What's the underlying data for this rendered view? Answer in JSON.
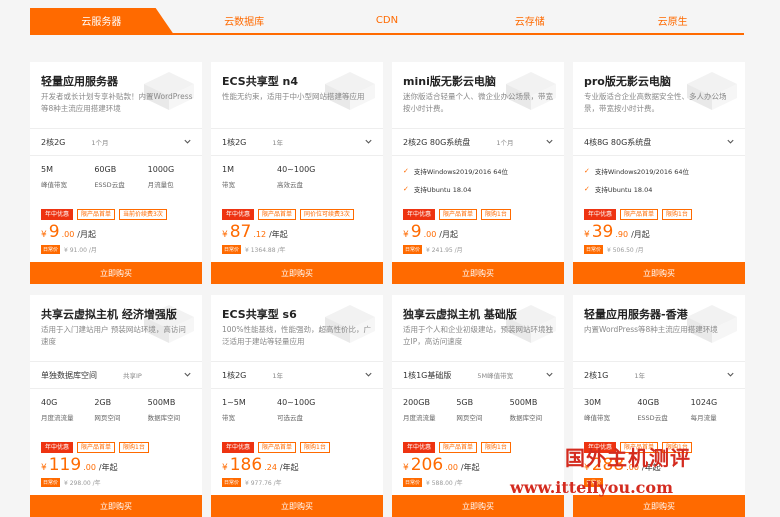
{
  "tabs": [
    "云服务器",
    "云数据库",
    "CDN",
    "云存储",
    "云原生"
  ],
  "cards": [
    {
      "title": "轻量应用服务器",
      "desc": "开发者或长计划专享补贴款！内置WordPress等8种主流应用搭建环境",
      "selector": "2核2G",
      "selector_sub": "1个月",
      "specs": [
        {
          "value": "5M",
          "label": "峰值带宽"
        },
        {
          "value": "60GB",
          "label": "ESSD云盘"
        },
        {
          "value": "1000G",
          "label": "月流量包"
        }
      ],
      "tags": [
        "年中优惠",
        "限产品首单",
        "当前价续费3次"
      ],
      "currency": "¥",
      "price_int": "9",
      "price_dec": ".00",
      "unit": "/月起",
      "orig_badge": "日常价",
      "orig": "¥ 91.00 /月",
      "buy": "立即购买"
    },
    {
      "title": "ECS共享型 n4",
      "desc": "性能无约束，适用于中小型网站搭建等应用",
      "selector": "1核2G",
      "selector_sub": "1年",
      "specs": [
        {
          "value": "1M",
          "label": "带宽"
        },
        {
          "value": "40~100G",
          "label": "高效云盘"
        }
      ],
      "tags": [
        "年中优惠",
        "限产品首单",
        "同价位可续费3次"
      ],
      "currency": "¥",
      "price_int": "87",
      "price_dec": ".12",
      "unit": "/年起",
      "orig_badge": "日常价",
      "orig": "¥ 1364.88 /年",
      "buy": "立即购买"
    },
    {
      "title": "mini版无影云电脑",
      "desc": "迷你版适合轻量个人、微企业办公场景，带宽按小时计费。",
      "selector": "2核2G 80G系统盘",
      "selector_sub": "1个月",
      "features": [
        "支持Windows2019/2016 64位",
        "支持Ubuntu 18.04"
      ],
      "tags": [
        "年中优惠",
        "限产品首单",
        "限购1台"
      ],
      "currency": "¥",
      "price_int": "9",
      "price_dec": ".00",
      "unit": "/月起",
      "orig_badge": "日常价",
      "orig": "¥ 241.95 /月",
      "buy": "立即购买"
    },
    {
      "title": "pro版无影云电脑",
      "desc": "专业版适合企业高数据安全性、多人办公场景，带宽按小时计费。",
      "selector": "4核8G 80G系统盘",
      "selector_sub": "",
      "features": [
        "支持Windows2019/2016 64位",
        "支持Ubuntu 18.04"
      ],
      "tags": [
        "年中优惠",
        "限产品首单",
        "限购1台"
      ],
      "currency": "¥",
      "price_int": "39",
      "price_dec": ".90",
      "unit": "/月起",
      "orig_badge": "日常价",
      "orig": "¥ 506.50 /月",
      "buy": "立即购买"
    },
    {
      "title": "共享云虚拟主机 经济增强版",
      "desc": "适用于入门建站用户 预装网站环境，高访问速度",
      "selector": "单独数据库空间",
      "selector_sub": "共享IP",
      "specs": [
        {
          "value": "40G",
          "label": "月度流流量"
        },
        {
          "value": "2GB",
          "label": "网页空间"
        },
        {
          "value": "500MB",
          "label": "数据库空间"
        }
      ],
      "tags": [
        "年中优惠",
        "限产品首单",
        "限购1台"
      ],
      "currency": "¥",
      "price_int": "119",
      "price_dec": ".00",
      "unit": "/年起",
      "orig_badge": "日常价",
      "orig": "¥ 298.00 /年",
      "buy": "立即购买"
    },
    {
      "title": "ECS共享型 s6",
      "desc": "100%性能基线，性能强劲，超高性价比，广泛适用于建站等轻量应用",
      "selector": "1核2G",
      "selector_sub": "1年",
      "specs": [
        {
          "value": "1~5M",
          "label": "带宽"
        },
        {
          "value": "40~100G",
          "label": "可选云盘"
        }
      ],
      "tags": [
        "年中优惠",
        "限产品首单",
        "限购1台"
      ],
      "currency": "¥",
      "price_int": "186",
      "price_dec": ".24",
      "unit": "/年起",
      "orig_badge": "日常价",
      "orig": "¥ 977.76 /年",
      "buy": "立即购买"
    },
    {
      "title": "独享云虚拟主机 基础版",
      "desc": "适用于个人和企业初级建站，预装网站环境独立IP，高访问速度",
      "selector": "1核1G基础版",
      "selector_sub": "5M峰值带宽",
      "specs": [
        {
          "value": "200GB",
          "label": "月度流流量"
        },
        {
          "value": "5GB",
          "label": "网页空间"
        },
        {
          "value": "500MB",
          "label": "数据库空间"
        }
      ],
      "tags": [
        "年中优惠",
        "限产品首单",
        "限购1台"
      ],
      "currency": "¥",
      "price_int": "206",
      "price_dec": ".00",
      "unit": "/年起",
      "orig_badge": "日常价",
      "orig": "¥ 588.00 /年",
      "buy": "立即购买"
    },
    {
      "title": "轻量应用服务器-香港",
      "desc": "内置WordPress等8种主流应用搭建环境",
      "selector": "2核1G",
      "selector_sub": "1年",
      "specs": [
        {
          "value": "30M",
          "label": "峰值带宽"
        },
        {
          "value": "40GB",
          "label": "ESSD云盘"
        },
        {
          "value": "1024G",
          "label": "每月流量"
        }
      ],
      "tags": [
        "年中优惠",
        "限产品首单",
        "限购1台"
      ],
      "currency": "¥",
      "price_int": "288",
      "price_dec": ".00",
      "unit": "/年起",
      "orig_badge": "日常价",
      "orig": "",
      "buy": "立即购买"
    }
  ],
  "watermark": {
    "line1": "国外主机测评",
    "line2": "www.ittellyou.com"
  }
}
